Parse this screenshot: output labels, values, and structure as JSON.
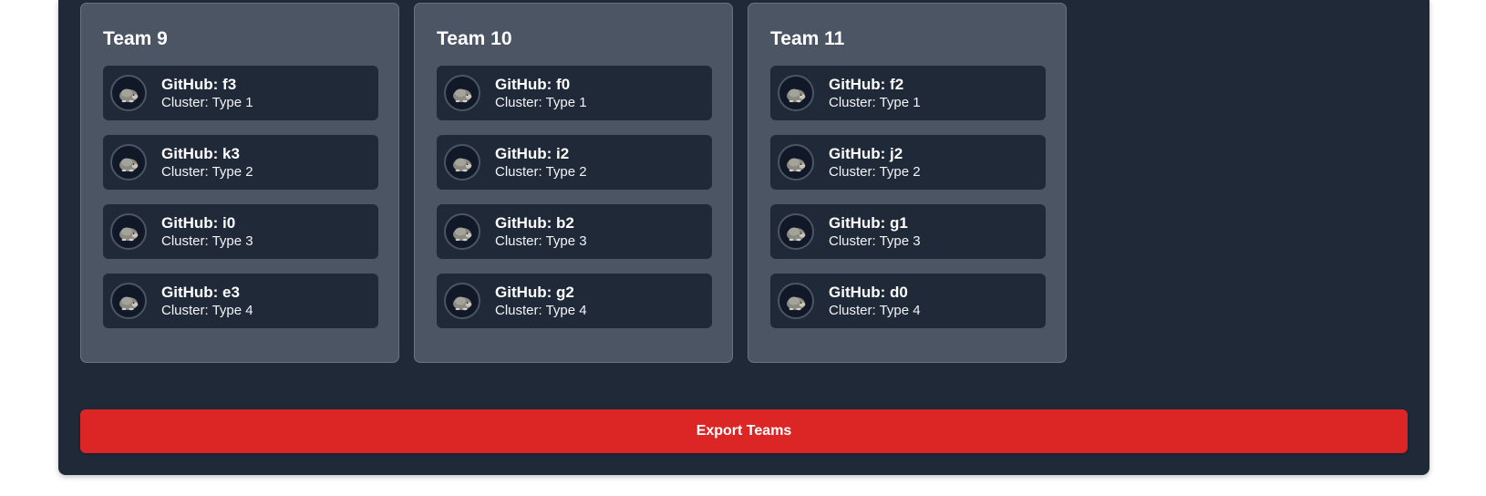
{
  "teams": [
    {
      "title": "Team 9",
      "members": [
        {
          "github": "GitHub: f3",
          "cluster": "Cluster: Type 1"
        },
        {
          "github": "GitHub: k3",
          "cluster": "Cluster: Type 2"
        },
        {
          "github": "GitHub: i0",
          "cluster": "Cluster: Type 3"
        },
        {
          "github": "GitHub: e3",
          "cluster": "Cluster: Type 4"
        }
      ]
    },
    {
      "title": "Team 10",
      "members": [
        {
          "github": "GitHub: f0",
          "cluster": "Cluster: Type 1"
        },
        {
          "github": "GitHub: i2",
          "cluster": "Cluster: Type 2"
        },
        {
          "github": "GitHub: b2",
          "cluster": "Cluster: Type 3"
        },
        {
          "github": "GitHub: g2",
          "cluster": "Cluster: Type 4"
        }
      ]
    },
    {
      "title": "Team 11",
      "members": [
        {
          "github": "GitHub: f2",
          "cluster": "Cluster: Type 1"
        },
        {
          "github": "GitHub: j2",
          "cluster": "Cluster: Type 2"
        },
        {
          "github": "GitHub: g1",
          "cluster": "Cluster: Type 3"
        },
        {
          "github": "GitHub: d0",
          "cluster": "Cluster: Type 4"
        }
      ]
    }
  ],
  "export_button": {
    "label": "Export Teams"
  },
  "icons": {
    "avatar": "mole-avatar-icon"
  },
  "colors": {
    "panel_bg": "#1f2937",
    "card_bg": "#4b5563",
    "member_bg": "#1f2937",
    "export_button": "#dc2626"
  }
}
